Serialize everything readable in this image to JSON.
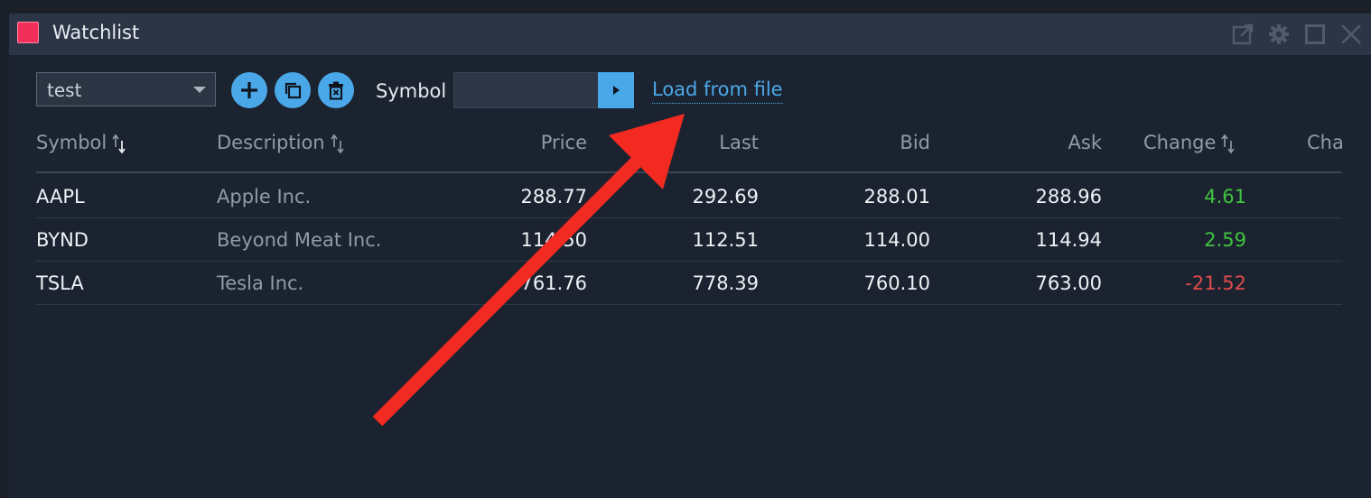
{
  "window": {
    "title": "Watchlist"
  },
  "toolbar": {
    "list_selected": "test",
    "symbol_label": "Symbol",
    "symbol_value": "",
    "load_link": "Load from file"
  },
  "columns": [
    {
      "key": "symbol",
      "label": "Symbol",
      "sort": "desc"
    },
    {
      "key": "description",
      "label": "Description",
      "sort": "none"
    },
    {
      "key": "price",
      "label": "Price"
    },
    {
      "key": "last",
      "label": "Last"
    },
    {
      "key": "bid",
      "label": "Bid"
    },
    {
      "key": "ask",
      "label": "Ask"
    },
    {
      "key": "change",
      "label": "Change",
      "sort": "none"
    },
    {
      "key": "cha",
      "label": "Cha"
    }
  ],
  "rows": [
    {
      "symbol": "AAPL",
      "description": "Apple Inc.",
      "price": "288.77",
      "last": "292.69",
      "bid": "288.01",
      "ask": "288.96",
      "change": "4.61",
      "change_color": "#3fc43f"
    },
    {
      "symbol": "BYND",
      "description": "Beyond Meat Inc.",
      "price": "114.50",
      "last": "112.51",
      "bid": "114.00",
      "ask": "114.94",
      "change": "2.59",
      "change_color": "#3fc43f"
    },
    {
      "symbol": "TSLA",
      "description": "Tesla Inc.",
      "price": "761.76",
      "last": "778.39",
      "bid": "760.10",
      "ask": "763.00",
      "change": "-21.52",
      "change_color": "#e04a4a"
    }
  ],
  "colors": {
    "accent": "#4aa8e8",
    "title_swatch": "#f0305a",
    "annotation_arrow": "#f22a22"
  },
  "icons": {
    "popout": "popout-icon",
    "settings": "gear-icon",
    "maximize": "maximize-icon",
    "close": "close-icon",
    "add": "plus-icon",
    "copy": "copy-icon",
    "delete": "trash-icon",
    "go": "play-arrow-icon"
  }
}
